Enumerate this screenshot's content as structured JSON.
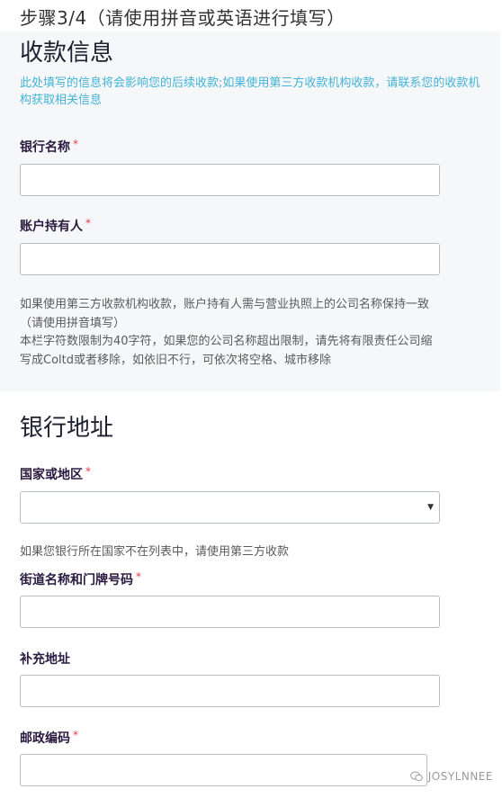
{
  "step": {
    "title": "步骤3/4（请使用拼音或英语进行填写）"
  },
  "payment": {
    "heading": "收款信息",
    "notice": "此处填写的信息将会影响您的后续收款;如果使用第三方收款机构收款，请联系您的收款机构获取相关信息",
    "bank_name": {
      "label": "银行名称",
      "required": "*",
      "value": ""
    },
    "account_holder": {
      "label": "账户持有人",
      "required": "*",
      "value": ""
    },
    "helper_line1": "如果使用第三方收款机构收款，账户持有人需与营业执照上的公司名称保持一致（请使用拼音填写）",
    "helper_line2": "本栏字符数限制为40字符，如果您的公司名称超出限制，请先将有限责任公司缩写成Coltd或者移除，如依旧不行，可依次将空格、城市移除"
  },
  "bank_address": {
    "heading": "银行地址",
    "country": {
      "label": "国家或地区",
      "required": "*",
      "selected": "",
      "icon": "caret-down-icon"
    },
    "country_note": "如果您银行所在国家不在列表中，请使用第三方收款",
    "street": {
      "label": "街道名称和门牌号码",
      "required": "*",
      "value": ""
    },
    "supplement": {
      "label": "补充地址",
      "value": ""
    },
    "postal": {
      "label": "邮政编码",
      "required": "*",
      "value": ""
    }
  },
  "watermark": {
    "text": "JOSYLNNEE",
    "icon": "wechat-icon"
  },
  "colors": {
    "accent_notice": "#43b3d7",
    "required": "#e2394c",
    "section_bg": "#f6f7f9",
    "label": "#2a1a3f"
  }
}
